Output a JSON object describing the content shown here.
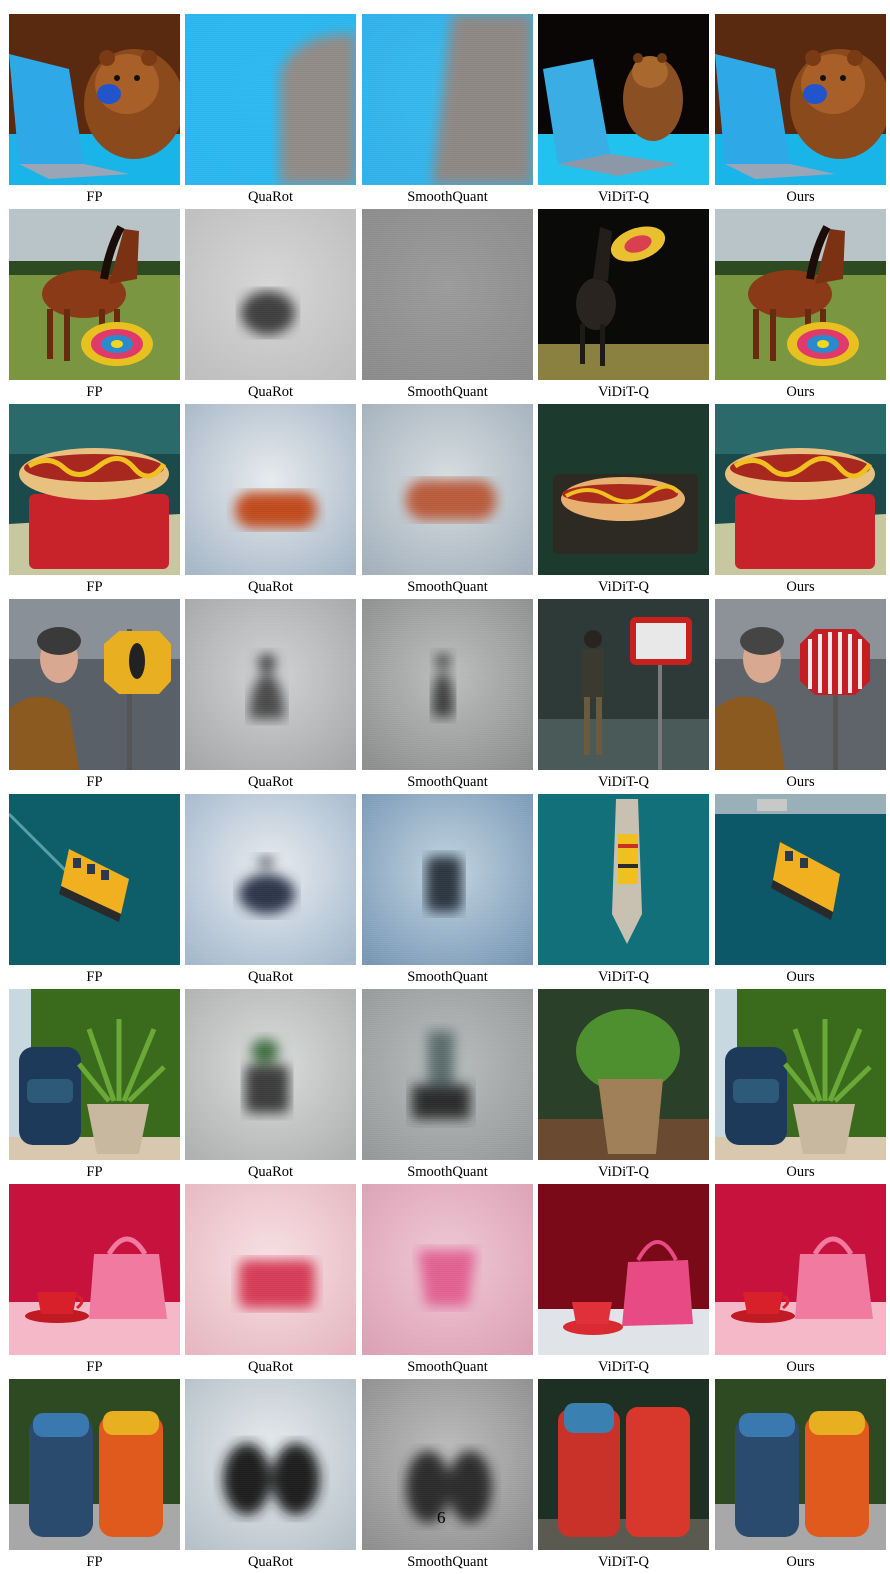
{
  "columns": [
    "FP",
    "QuaRot",
    "SmoothQuant",
    "ViDiT-Q",
    "Ours"
  ],
  "page_number": "6",
  "rows": [
    {
      "scene": "bear-laptop",
      "cells": [
        {
          "art": "bear-laptop",
          "caption": "FP"
        },
        {
          "art": "blur-blue",
          "caption": "QuaRot"
        },
        {
          "art": "blur-blue-2",
          "caption": "SmoothQuant"
        },
        {
          "art": "bear-laptop-dark",
          "caption": "ViDiT-Q"
        },
        {
          "art": "bear-laptop",
          "caption": "Ours"
        }
      ]
    },
    {
      "scene": "horse-frisbee",
      "cells": [
        {
          "art": "horse-frisbee",
          "caption": "FP"
        },
        {
          "art": "blur-dot",
          "caption": "QuaRot"
        },
        {
          "art": "blur-grey",
          "caption": "SmoothQuant"
        },
        {
          "art": "horse-dark",
          "caption": "ViDiT-Q"
        },
        {
          "art": "horse-frisbee",
          "caption": "Ours"
        }
      ]
    },
    {
      "scene": "hotdog-suitcase",
      "cells": [
        {
          "art": "hotdog",
          "caption": "FP"
        },
        {
          "art": "blur-hotdog",
          "caption": "QuaRot"
        },
        {
          "art": "blur-hotdog-2",
          "caption": "SmoothQuant"
        },
        {
          "art": "hotdog-dark",
          "caption": "ViDiT-Q"
        },
        {
          "art": "hotdog",
          "caption": "Ours"
        }
      ]
    },
    {
      "scene": "person-stopsign",
      "cells": [
        {
          "art": "person-sign",
          "caption": "FP"
        },
        {
          "art": "blur-person",
          "caption": "QuaRot"
        },
        {
          "art": "blur-person-2",
          "caption": "SmoothQuant"
        },
        {
          "art": "person-street",
          "caption": "ViDiT-Q"
        },
        {
          "art": "person-stop",
          "caption": "Ours"
        }
      ]
    },
    {
      "scene": "bus-water",
      "cells": [
        {
          "art": "bus-water",
          "caption": "FP"
        },
        {
          "art": "blur-boat",
          "caption": "QuaRot"
        },
        {
          "art": "blur-boat-2",
          "caption": "SmoothQuant"
        },
        {
          "art": "boat-water",
          "caption": "ViDiT-Q"
        },
        {
          "art": "bus-water-2",
          "caption": "Ours"
        }
      ]
    },
    {
      "scene": "backpack-plant",
      "cells": [
        {
          "art": "backpack-plant",
          "caption": "FP"
        },
        {
          "art": "blur-plant",
          "caption": "QuaRot"
        },
        {
          "art": "blur-plant-2",
          "caption": "SmoothQuant"
        },
        {
          "art": "plant-cafe",
          "caption": "ViDiT-Q"
        },
        {
          "art": "backpack-plant",
          "caption": "Ours"
        }
      ]
    },
    {
      "scene": "cup-handbag",
      "cells": [
        {
          "art": "cup-bag",
          "caption": "FP"
        },
        {
          "art": "blur-cup",
          "caption": "QuaRot"
        },
        {
          "art": "blur-cup-2",
          "caption": "SmoothQuant"
        },
        {
          "art": "cup-bag-dark",
          "caption": "ViDiT-Q"
        },
        {
          "art": "cup-bag",
          "caption": "Ours"
        }
      ]
    },
    {
      "scene": "two-backpacks",
      "cells": [
        {
          "art": "backpacks",
          "caption": "FP"
        },
        {
          "art": "blur-backpacks",
          "caption": "QuaRot"
        },
        {
          "art": "blur-backpacks-2",
          "caption": "SmoothQuant"
        },
        {
          "art": "backpacks-red",
          "caption": "ViDiT-Q"
        },
        {
          "art": "backpacks",
          "caption": "Ours"
        }
      ]
    }
  ]
}
